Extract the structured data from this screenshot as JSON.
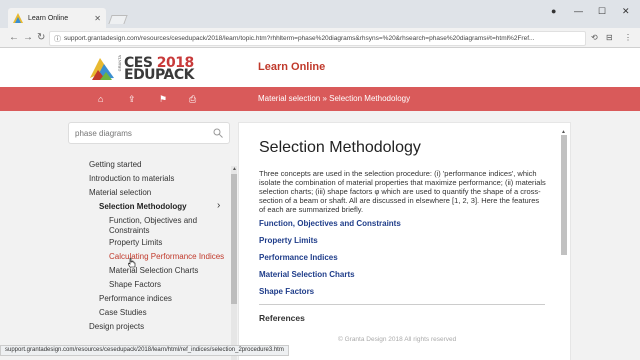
{
  "browser": {
    "tab_title": "Learn Online",
    "url": "support.grantadesign.com/resources/cesedupack/2018/learn/topic.htm?rhhlterm=phase%20diagrams&rhsyns=%20&rhsearch=phase%20diagrams#t=html%2Fref...",
    "status_url": "support.grantadesign.com/resources/cesedupack/2018/learn/html/ref_indices/selection_2procedure3.htm"
  },
  "header": {
    "logo_line1": "CES 2018",
    "logo_line2": "EDUPACK",
    "logo_brand": "GRANTA",
    "site_title": "Learn Online",
    "breadcrumb": "Material selection » Selection Methodology"
  },
  "sidebar": {
    "search_placeholder": "phase diagrams",
    "items": [
      {
        "label": "Getting started"
      },
      {
        "label": "Introduction to materials"
      },
      {
        "label": "Material selection"
      },
      {
        "label": "Selection Methodology"
      },
      {
        "label": "Function, Objectives and Constraints"
      },
      {
        "label": "Property Limits"
      },
      {
        "label": "Calculating Performance Indices"
      },
      {
        "label": "Material Selection Charts"
      },
      {
        "label": "Shape Factors"
      },
      {
        "label": "Performance indices"
      },
      {
        "label": "Case Studies"
      },
      {
        "label": "Design projects"
      }
    ]
  },
  "content": {
    "title": "Selection Methodology",
    "intro": "Three concepts are used in the selection procedure: (i) 'performance indices', which isolate the combination of material properties that maximize performance; (ii) materials selection charts; (iii) shape factors φ which are used to quantify the shape of a cross-section of a beam or shaft. All are discussed in elsewhere [1, 2, 3]. Here the features of each are summarized briefly.",
    "links": [
      {
        "label": "Function, Objectives and Constraints"
      },
      {
        "label": "Property Limits"
      },
      {
        "label": "Performance Indices"
      },
      {
        "label": "Material Selection Charts"
      },
      {
        "label": "Shape Factors"
      }
    ],
    "references_heading": "References"
  },
  "footer": {
    "copyright": "© Granta Design 2018 All rights reserved"
  },
  "colors": {
    "accent": "#c0392b",
    "redbar": "#d95a5a",
    "link": "#1f3d8a"
  }
}
